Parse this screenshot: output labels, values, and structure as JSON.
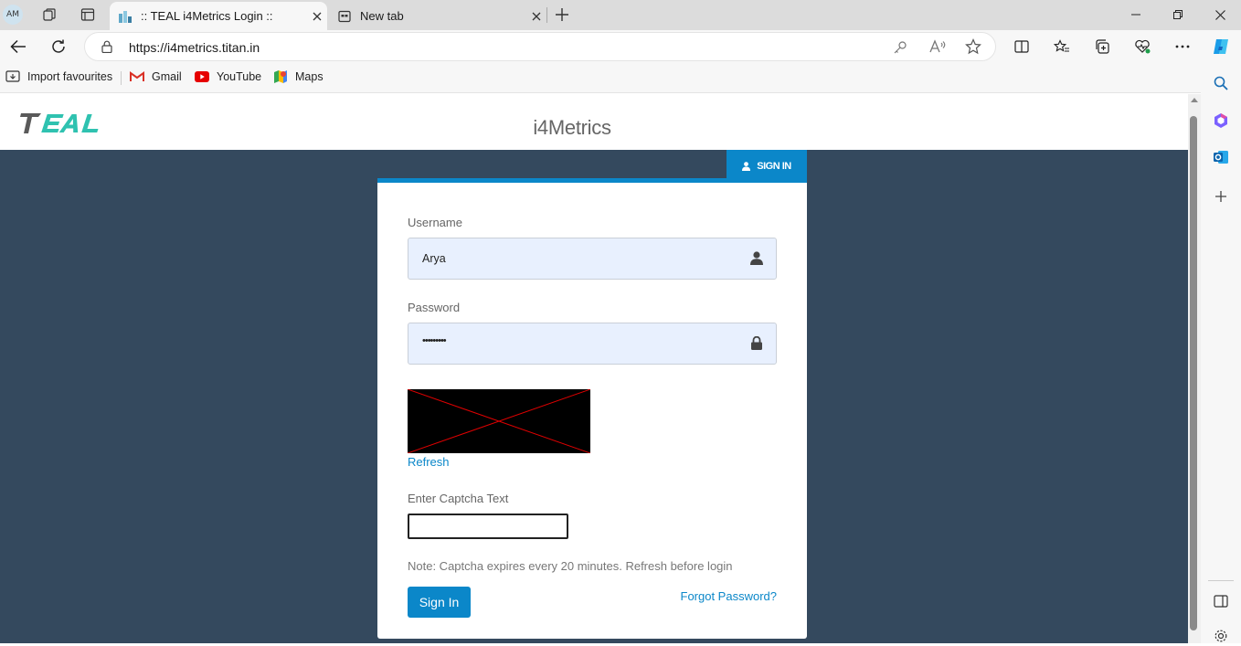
{
  "browser": {
    "profile_initials": "AM",
    "tabs": [
      {
        "title": ":: TEAL i4Metrics Login ::",
        "active": true
      },
      {
        "title": "New tab",
        "active": false
      }
    ],
    "url": "https://i4metrics.titan.in",
    "favourites": [
      {
        "label": "Import favourites",
        "icon": "import-icon"
      },
      {
        "label": "Gmail",
        "icon": "gmail-icon"
      },
      {
        "label": "YouTube",
        "icon": "youtube-icon"
      },
      {
        "label": "Maps",
        "icon": "maps-icon"
      }
    ]
  },
  "site": {
    "logo_text": "TEAL",
    "title": "i4Metrics",
    "sign_in_tab": "SIGN IN"
  },
  "form": {
    "username_label": "Username",
    "username_value": "Arya",
    "password_label": "Password",
    "password_value": "•••••••••",
    "refresh_label": "Refresh",
    "captcha_label": "Enter Captcha Text",
    "captcha_value": "",
    "note": "Note: Captcha expires every 20 minutes. Refresh before login",
    "submit_label": "Sign In",
    "forgot_label": "Forgot Password?"
  },
  "colors": {
    "accent": "#0b87c9",
    "page_bg": "#34495e",
    "field_bg": "#e8f0fe"
  }
}
